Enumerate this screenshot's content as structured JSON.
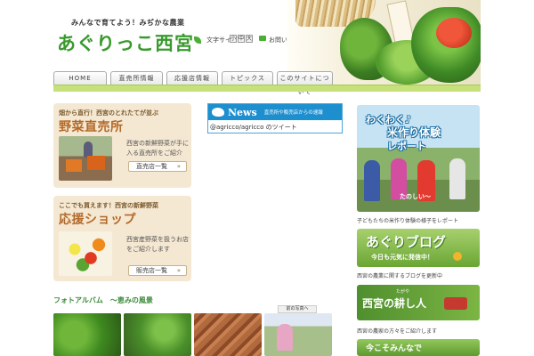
{
  "header": {
    "tagline": "みんなで育てよう！みぢかな農業",
    "logo": "あぐりっこ西宮",
    "font_size_label": "文字サイズ",
    "font_buttons": [
      "小",
      "中",
      "大"
    ],
    "contact_label": "お問い合わせ"
  },
  "nav": {
    "items": [
      {
        "label": "HOME"
      },
      {
        "label": "直売所情報"
      },
      {
        "label": "応援店情報"
      },
      {
        "label": "トピックス"
      },
      {
        "label": "このサイトについて"
      }
    ]
  },
  "promo_cards": [
    {
      "subtitle": "畑から直行！西宮のとれたてが並ぶ",
      "title": "野菜直売所",
      "description": "西宮の新鮮野菜が手に入る直売所をご紹介",
      "button_label": "直売店一覧"
    },
    {
      "subtitle": "ここでも買えます！西宮の新鮮野菜",
      "title": "応援ショップ",
      "description": "西宮産野菜を扱うお店をご紹介します",
      "button_label": "販売店一覧"
    }
  ],
  "news": {
    "title": "News",
    "description": "直売所や販売店からの速報",
    "feed_text": "@agricco/agricco のツイート"
  },
  "right_banners": {
    "rice": {
      "line1": "わくわく♪",
      "line2": "米作り体験",
      "line3": "レポート",
      "small": "たのしい〜",
      "caption": "子どもたちの米作り体験の様子をレポート"
    },
    "blog": {
      "title": "あぐりブログ",
      "subtitle": "今日も元気に発信中！",
      "caption": "西宮の農業に関するブログを更新中"
    },
    "farmer": {
      "title": "西宮の耕し人",
      "ruby": "たがや",
      "caption": "西宮の農家の方々をご紹介します"
    },
    "bottom": {
      "title": "今こそみんなで"
    }
  },
  "album": {
    "title": "フォトアルバム　～恵みの風景",
    "photo_label": "前の写真へ"
  }
}
